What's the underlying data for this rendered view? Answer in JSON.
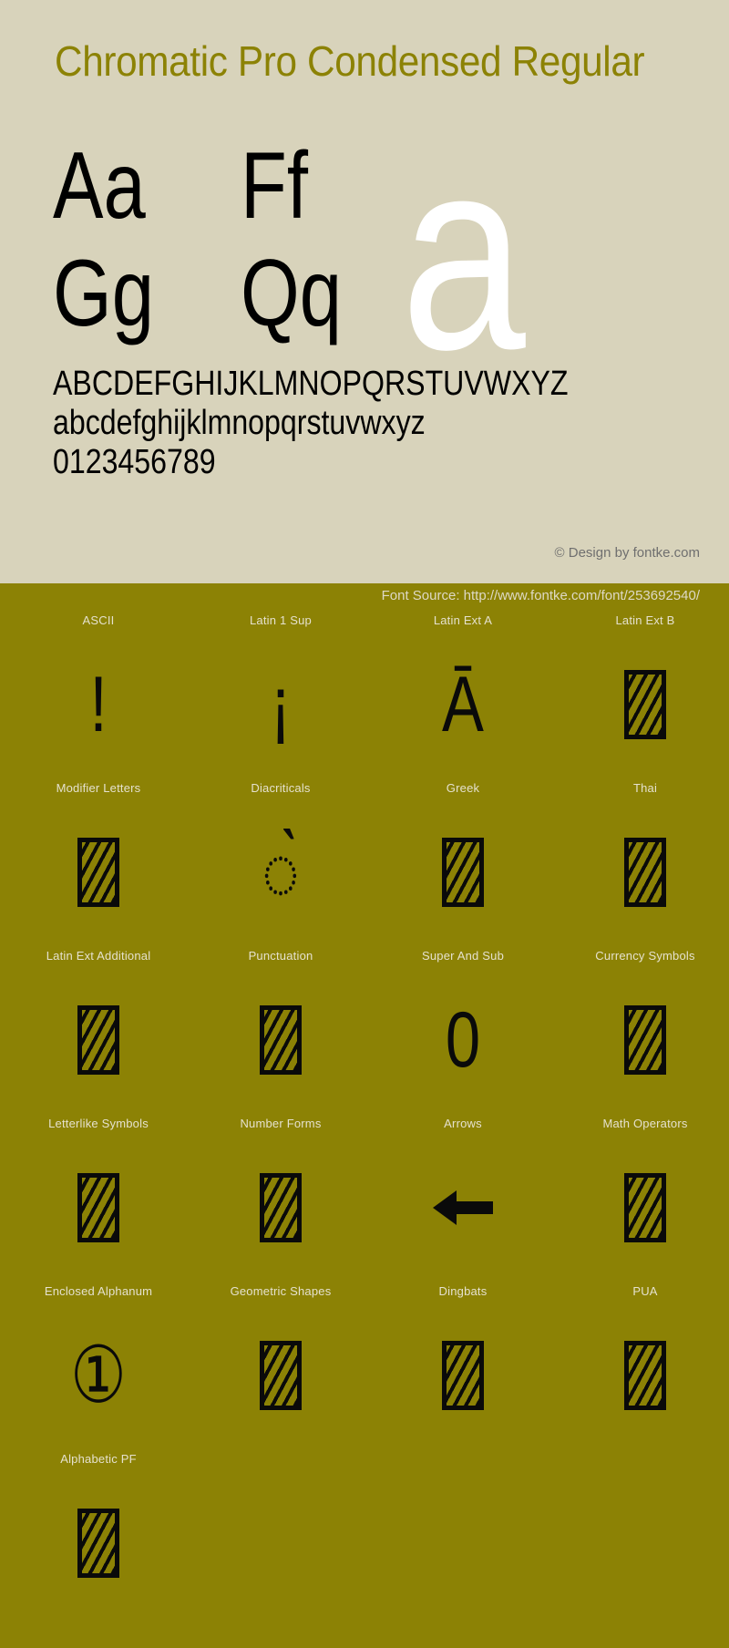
{
  "header": {
    "font_title": "Chromatic Pro Condensed Regular"
  },
  "specimen": {
    "waterfall": [
      {
        "left": "Aa",
        "right": "Ff"
      },
      {
        "left": "Gg",
        "right": "Qq"
      }
    ],
    "display_glyph": "a",
    "uppercase": "ABCDEFGHIJKLMNOPQRSTUVWXYZ",
    "lowercase": "abcdefghijklmnopqrstuvwxyz",
    "digits": "0123456789",
    "credit": "© Design by fontke.com"
  },
  "source_bar": {
    "text": "Font Source: http://www.fontke.com/font/253692540/"
  },
  "unicode_blocks": {
    "rows": [
      [
        {
          "label": "ASCII",
          "glyph": "!",
          "kind": "char"
        },
        {
          "label": "Latin 1 Sup",
          "glyph": "¡",
          "kind": "char"
        },
        {
          "label": "Latin Ext A",
          "glyph": "Ā",
          "kind": "char"
        },
        {
          "label": "Latin Ext B",
          "glyph": "",
          "kind": "tofu"
        }
      ],
      [
        {
          "label": "Modifier Letters",
          "glyph": "",
          "kind": "tofu"
        },
        {
          "label": "Diacriticals",
          "glyph": "◌̀",
          "kind": "char"
        },
        {
          "label": "Greek",
          "glyph": "",
          "kind": "tofu"
        },
        {
          "label": "Thai",
          "glyph": "",
          "kind": "tofu"
        }
      ],
      [
        {
          "label": "Latin Ext Additional",
          "glyph": "",
          "kind": "tofu"
        },
        {
          "label": "Punctuation",
          "glyph": "",
          "kind": "tofu"
        },
        {
          "label": "Super And Sub",
          "glyph": "0",
          "kind": "char"
        },
        {
          "label": "Currency Symbols",
          "glyph": "",
          "kind": "tofu"
        }
      ],
      [
        {
          "label": "Letterlike Symbols",
          "glyph": "",
          "kind": "tofu"
        },
        {
          "label": "Number Forms",
          "glyph": "",
          "kind": "tofu"
        },
        {
          "label": "Arrows",
          "glyph": "←",
          "kind": "arrow"
        },
        {
          "label": "Math Operators",
          "glyph": "",
          "kind": "tofu"
        }
      ],
      [
        {
          "label": "Enclosed Alphanum",
          "glyph": "①",
          "kind": "char"
        },
        {
          "label": "Geometric Shapes",
          "glyph": "",
          "kind": "tofu"
        },
        {
          "label": "Dingbats",
          "glyph": "",
          "kind": "tofu"
        },
        {
          "label": "PUA",
          "glyph": "",
          "kind": "tofu"
        }
      ],
      [
        {
          "label": "Alphabetic PF",
          "glyph": "",
          "kind": "tofu"
        }
      ]
    ]
  },
  "colors": {
    "paper": "#d8d3bb",
    "olive": "#8c8205",
    "title": "#8c8205",
    "glyph_black": "#0a0a0a",
    "display_white": "#ffffff",
    "credit_gray": "#6f6f6f",
    "source_text": "#ded9c6"
  }
}
